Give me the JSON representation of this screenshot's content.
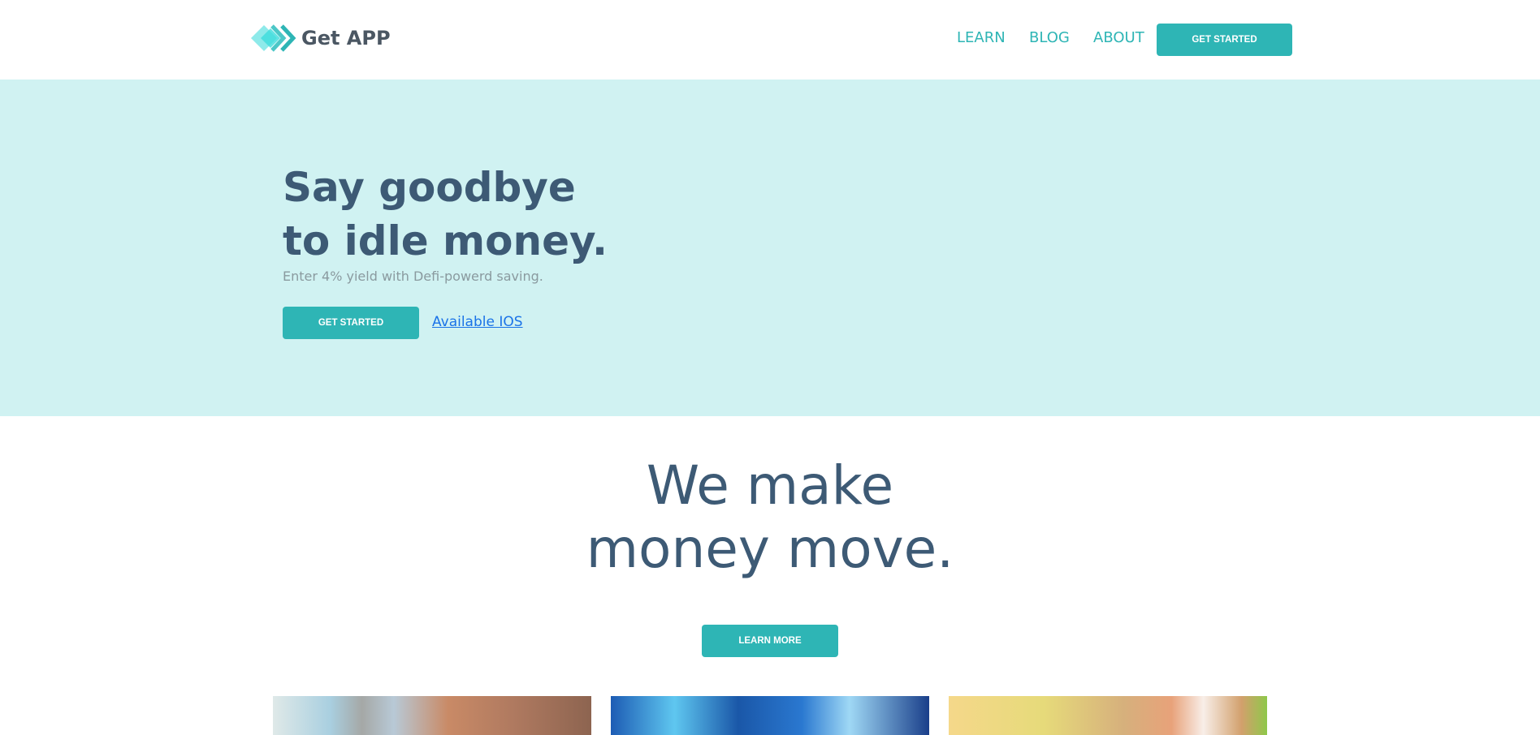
{
  "nav": {
    "logo_text": "Get APP",
    "links": [
      "LEARN",
      "BLOG",
      "ABOUT"
    ],
    "cta": "GET STARTED"
  },
  "hero": {
    "title_line1": "Say goodbye",
    "title_line2": "to idle money.",
    "subtitle": "Enter 4% yield with Defi-powerd saving.",
    "cta": "GET STARTED",
    "ios_link": "Available IOS"
  },
  "section": {
    "title_line1": "We make",
    "title_line2": "money move.",
    "cta": "LEARN MORE"
  },
  "colors": {
    "accent": "#2eb5b5",
    "heading": "#3d5a75",
    "hero_bg": "#d0f2f2"
  }
}
